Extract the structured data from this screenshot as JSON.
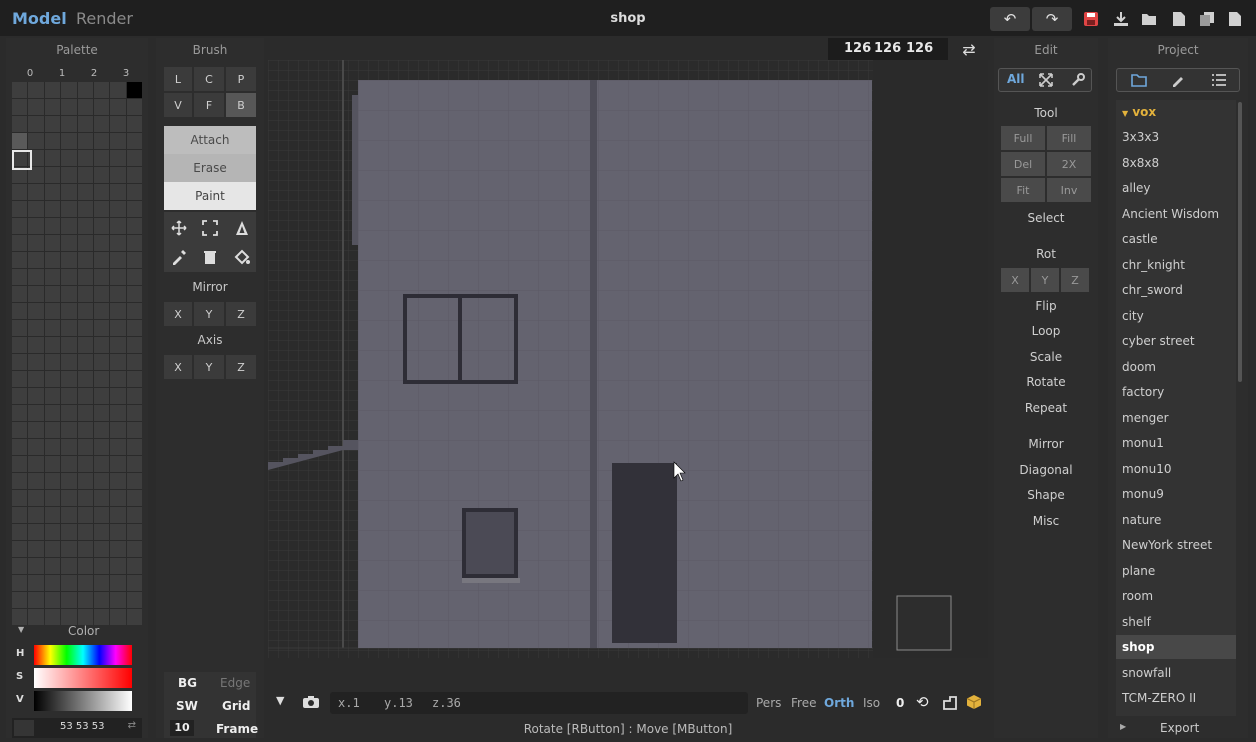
{
  "topbar": {
    "mode_model": "Model",
    "mode_render": "Render",
    "title": "shop",
    "undo_icon": "undo-icon",
    "redo_icon": "redo-icon"
  },
  "palette": {
    "title": "Palette",
    "columns": [
      "0",
      "1",
      "2",
      "3"
    ],
    "color_title": "Color",
    "h_label": "H",
    "s_label": "S",
    "v_label": "V",
    "rgb": "53 53 53"
  },
  "brush": {
    "title": "Brush",
    "row1": [
      "L",
      "C",
      "P"
    ],
    "row2": [
      "V",
      "F",
      "B"
    ],
    "attach": "Attach",
    "erase": "Erase",
    "paint": "Paint",
    "mirror": "Mirror",
    "axis": "Axis",
    "mirror_axes": [
      "X",
      "Y",
      "Z"
    ],
    "axis_axes": [
      "X",
      "Y",
      "Z"
    ],
    "bg": "BG",
    "edge": "Edge",
    "sw": "SW",
    "grid": "Grid",
    "grid_size": "10",
    "frame": "Frame"
  },
  "viewport": {
    "dims": [
      "126",
      "126",
      "126"
    ],
    "cursor_x": "x.1",
    "cursor_y": "y.13",
    "cursor_z": "z.36",
    "views": [
      "Pers",
      "Free",
      "Orth",
      "Iso"
    ],
    "active_view": "Orth",
    "view_count": "0",
    "status": "Rotate [RButton] : Move [MButton]"
  },
  "edit": {
    "title": "Edit",
    "tabs": [
      "All"
    ],
    "tool_label": "Tool",
    "tool_buttons": [
      "Full",
      "Fill",
      "Del",
      "2X",
      "Fit",
      "Inv"
    ],
    "select_label": "Select",
    "rot_label": "Rot",
    "rot_axes": [
      "X",
      "Y",
      "Z"
    ],
    "ops": [
      "Flip",
      "Loop",
      "Scale",
      "Rotate",
      "Repeat"
    ],
    "ops2": [
      "Mirror",
      "Diagonal",
      "Shape",
      "Misc"
    ]
  },
  "project": {
    "title": "Project",
    "folder": "vox",
    "items": [
      "3x3x3",
      "8x8x8",
      "alley",
      "Ancient Wisdom",
      "castle",
      "chr_knight",
      "chr_sword",
      "city",
      "cyber street",
      "doom",
      "factory",
      "menger",
      "monu1",
      "monu10",
      "monu9",
      "nature",
      "NewYork street",
      "plane",
      "room",
      "shelf",
      "shop",
      "snowfall",
      "TCM-ZERO II"
    ],
    "selected": "shop",
    "export": "Export"
  },
  "colors": {
    "accent": "#6fa8dc",
    "save": "#e04545",
    "folder": "#e3b23c",
    "wall": "#64636f"
  }
}
